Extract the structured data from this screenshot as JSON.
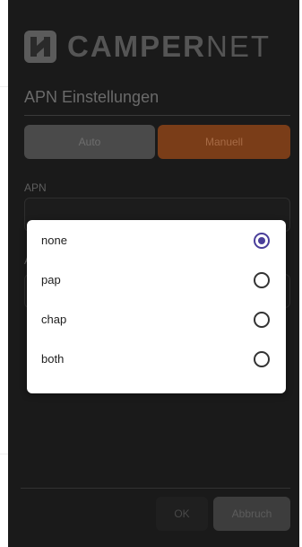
{
  "brand": {
    "logo_bold": "CAMPER",
    "logo_light": "NET"
  },
  "screen": {
    "title": "APN Einstellungen"
  },
  "mode_toggle": {
    "auto_label": "Auto",
    "manual_label": "Manuell",
    "selected": "Manuell"
  },
  "apn_field": {
    "label": "APN",
    "value": ""
  },
  "second_field": {
    "label": "A",
    "value": ""
  },
  "auth_dialog": {
    "options": [
      {
        "label": "none",
        "selected": true
      },
      {
        "label": "pap",
        "selected": false
      },
      {
        "label": "chap",
        "selected": false
      },
      {
        "label": "both",
        "selected": false
      }
    ]
  },
  "footer": {
    "ok_label": "OK",
    "cancel_label": "Abbruch"
  },
  "colors": {
    "background": "#1a1a1a",
    "accent": "#7a3d18",
    "radio_accent": "#4a3f9a"
  }
}
